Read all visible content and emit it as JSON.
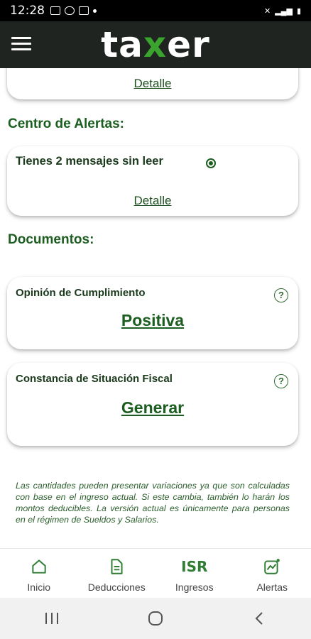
{
  "status_bar": {
    "time": "12:28"
  },
  "header": {
    "logo_prefix": "ta",
    "logo_x": "x",
    "logo_suffix": "er"
  },
  "top_card": {
    "detail_label": "Detalle"
  },
  "alerts": {
    "section_title": "Centro de Alertas:",
    "message": "Tienes 2 mensajes sin leer",
    "detail_label": "Detalle"
  },
  "documents": {
    "section_title": "Documentos:",
    "items": [
      {
        "title": "Opinión de Cumplimiento",
        "value": "Positiva",
        "help": "?"
      },
      {
        "title": "Constancia de Situación Fiscal",
        "value": "Generar",
        "help": "?"
      }
    ]
  },
  "disclaimer": "Las cantidades pueden presentar variaciones ya que son calculadas con base en el ingreso actual. Si este cambia, también lo harán los montos deducibles. La versión actual es únicamente para personas en el régimen de Sueldos y Salarios.",
  "bottom_nav": {
    "items": [
      {
        "label": "Inicio",
        "icon": "home-icon"
      },
      {
        "label": "Deducciones",
        "icon": "document-icon"
      },
      {
        "label": "Ingresos",
        "icon_text": "ISR"
      },
      {
        "label": "Alertas",
        "icon": "chart-alert-icon"
      }
    ]
  },
  "colors": {
    "accent": "#1b5e20",
    "logo_x": "#3ba42f",
    "header_bg": "#1f2421"
  }
}
